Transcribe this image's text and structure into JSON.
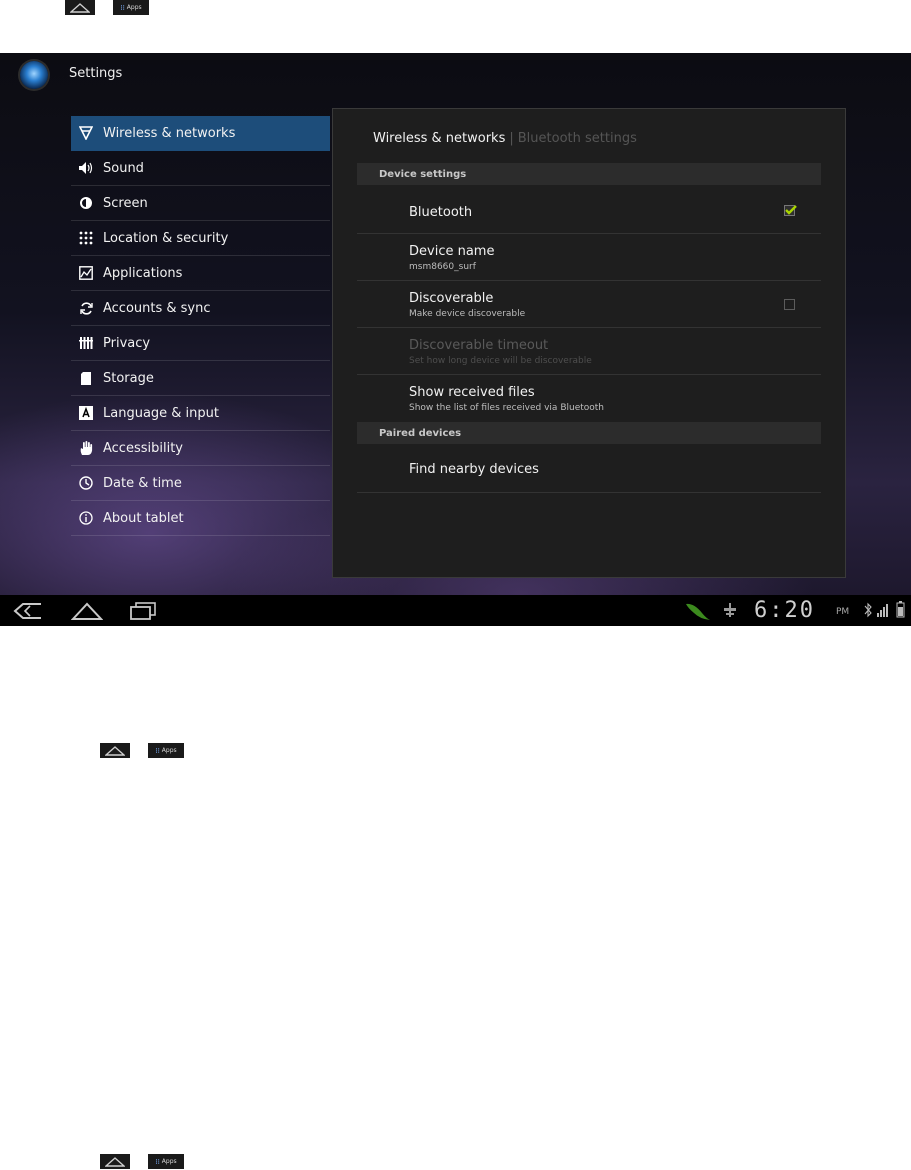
{
  "mini_nav": {
    "apps_label": "Apps"
  },
  "app_bar": {
    "title": "Settings"
  },
  "nav": {
    "items": [
      {
        "label": "Wireless & networks",
        "icon": "wifi-icon"
      },
      {
        "label": "Sound",
        "icon": "speaker-icon"
      },
      {
        "label": "Screen",
        "icon": "brightness-icon"
      },
      {
        "label": "Location & security",
        "icon": "grid-dots-icon"
      },
      {
        "label": "Applications",
        "icon": "applications-icon"
      },
      {
        "label": "Accounts & sync",
        "icon": "sync-icon"
      },
      {
        "label": "Privacy",
        "icon": "privacy-icon"
      },
      {
        "label": "Storage",
        "icon": "sd-card-icon"
      },
      {
        "label": "Language & input",
        "icon": "language-icon"
      },
      {
        "label": "Accessibility",
        "icon": "hand-icon"
      },
      {
        "label": "Date & time",
        "icon": "clock-icon"
      },
      {
        "label": "About tablet",
        "icon": "info-icon"
      }
    ],
    "active_index": 0
  },
  "panel": {
    "breadcrumb": {
      "current": "Wireless & networks",
      "separator": "|",
      "next": "Bluetooth settings"
    },
    "device_settings_header": "Device settings",
    "bluetooth": {
      "title": "Bluetooth",
      "checked": true
    },
    "device_name": {
      "title": "Device name",
      "value": "msm8660_surf"
    },
    "discoverable": {
      "title": "Discoverable",
      "summary": "Make device discoverable",
      "checked": false
    },
    "discoverable_timeout": {
      "title": "Discoverable timeout",
      "summary": "Set how long device will be discoverable",
      "enabled": false
    },
    "received_files": {
      "title": "Show received files",
      "summary": "Show the list of files received via Bluetooth"
    },
    "paired_devices_header": "Paired devices",
    "find_nearby": {
      "title": "Find nearby devices"
    }
  },
  "status_bar": {
    "time": "6:20",
    "ampm": "PM"
  },
  "colors": {
    "accent": "#1d4d7a",
    "check": "#a8d400"
  }
}
